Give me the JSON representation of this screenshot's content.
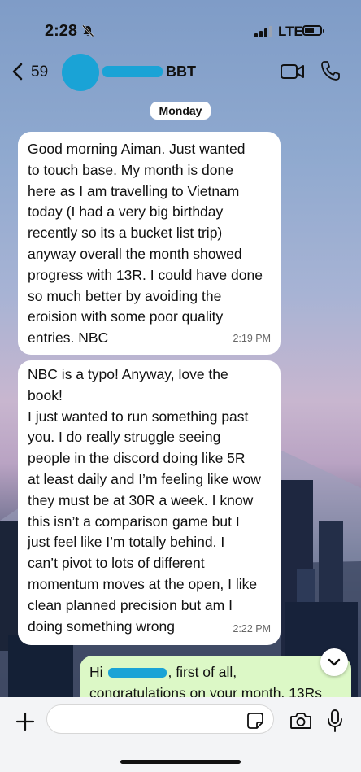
{
  "status_bar": {
    "time": "2:28",
    "network": "LTE"
  },
  "header": {
    "back_count": "59",
    "contact_name_visible": "BBT"
  },
  "day_label": "Monday",
  "messages": [
    {
      "text": "Good morning Aiman. Just wanted\nto touch base. My month is done\nhere as I am travelling to Vietnam\ntoday (I had a very big birthday\nrecently so its a bucket list trip)\nanyway overall the month showed\nprogress with 13R. I could have done\nso much better by avoiding the\neroision with some poor quality\nentries. NBC",
      "time": "2:19 PM"
    },
    {
      "text": "NBC is a typo! Anyway, love the\nbook!\nI just wanted to run something past\nyou. I do really struggle seeing\npeople in the discord doing like 5R\nat least daily and I’m feeling like wow\nthey must be at 30R a week. I know\nthis isn’t a comparison game but I\njust feel like I’m totally behind. I\ncan’t pivot to lots of different\nmomentum moves at the open, I like\nclean planned precision but am I\ndoing something wrong",
      "time": "2:22 PM"
    }
  ],
  "reply": {
    "greeting": "Hi",
    "rest": ", first of all,",
    "line2": "congratulations on your month. 13Rs"
  },
  "icons": {
    "back": "chevron-left-icon",
    "video": "video-camera-icon",
    "phone": "phone-icon",
    "plus": "plus-icon",
    "sticker": "sticker-icon",
    "camera": "camera-icon",
    "mic": "microphone-icon",
    "scroll": "chevron-down-icon"
  },
  "colors": {
    "accent": "#1aa3d6",
    "outgoing_bubble": "#dcf8c6",
    "incoming_bubble": "#ffffff"
  }
}
